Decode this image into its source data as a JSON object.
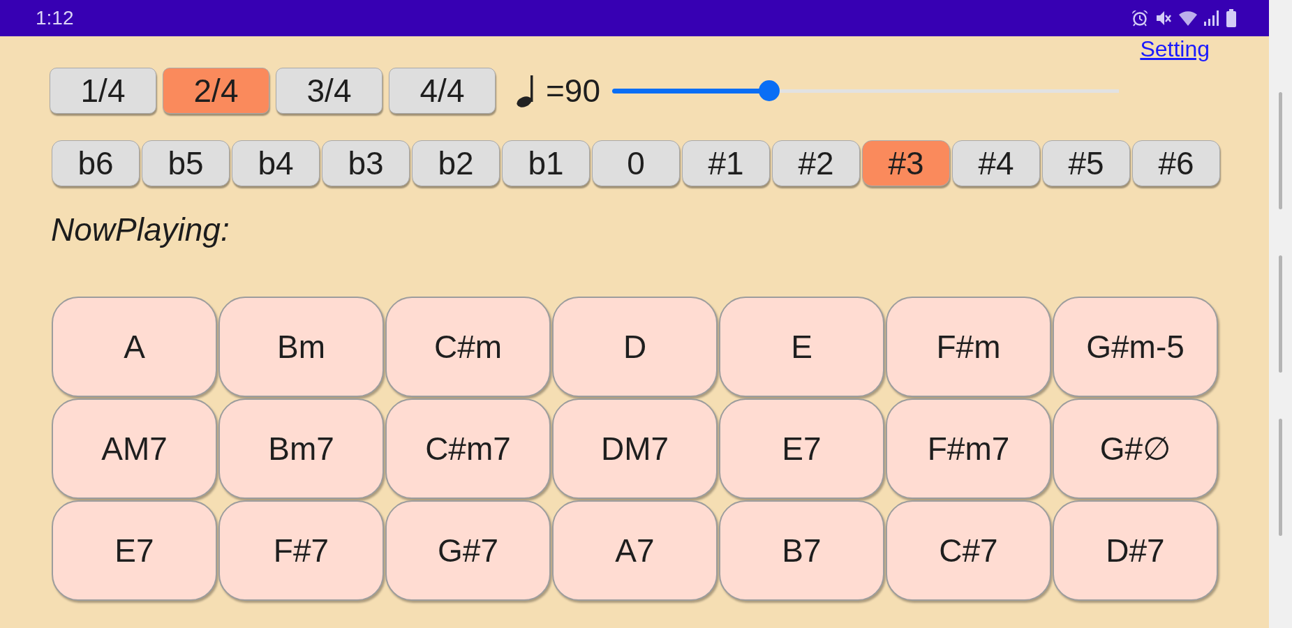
{
  "status_bar": {
    "time": "1:12"
  },
  "setting_link": {
    "label": "Setting"
  },
  "time_signatures": [
    {
      "label": "1/4",
      "selected": false
    },
    {
      "label": "2/4",
      "selected": true
    },
    {
      "label": "3/4",
      "selected": false
    },
    {
      "label": "4/4",
      "selected": false
    }
  ],
  "tempo": {
    "value": "=90",
    "level": 0.31
  },
  "keys": [
    {
      "label": "b6",
      "selected": false
    },
    {
      "label": "b5",
      "selected": false
    },
    {
      "label": "b4",
      "selected": false
    },
    {
      "label": "b3",
      "selected": false
    },
    {
      "label": "b2",
      "selected": false
    },
    {
      "label": "b1",
      "selected": false
    },
    {
      "label": "0",
      "selected": false
    },
    {
      "label": "#1",
      "selected": false
    },
    {
      "label": "#2",
      "selected": false
    },
    {
      "label": "#3",
      "selected": true
    },
    {
      "label": "#4",
      "selected": false
    },
    {
      "label": "#5",
      "selected": false
    },
    {
      "label": "#6",
      "selected": false
    }
  ],
  "now_playing": {
    "label": "NowPlaying:"
  },
  "chord_rows": [
    {
      "chords": [
        "A",
        "Bm",
        "C#m",
        "D",
        "E",
        "F#m",
        "G#m-5"
      ]
    },
    {
      "chords": [
        "AM7",
        "Bm7",
        "C#m7",
        "DM7",
        "E7",
        "F#m7",
        "G#∅"
      ]
    },
    {
      "chords": [
        "E7",
        "F#7",
        "G#7",
        "A7",
        "B7",
        "C#7",
        "D#7"
      ]
    }
  ]
}
